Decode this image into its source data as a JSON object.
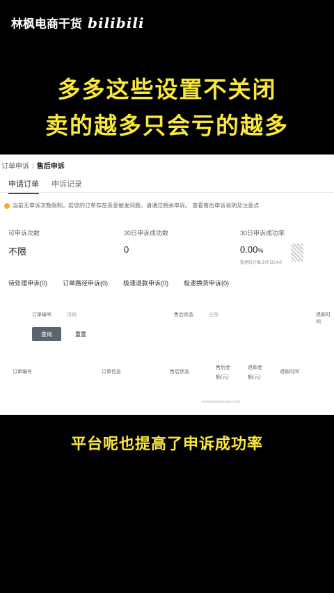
{
  "brand": {
    "name": "林枫电商干货",
    "logo": "bilibili"
  },
  "headline": {
    "line1": "多多这些设置不关闭",
    "line2": "卖的越多只会亏的越多"
  },
  "screenshot": {
    "breadcrumb": {
      "parent": "订单申诉",
      "current": "售后申诉"
    },
    "tabs": [
      "申请订单",
      "申诉记录"
    ],
    "notice": "当前无申诉次数限制，若您的订单存在恶意催发问题，请通过相关申诉。 查看售后申诉说明及注意点",
    "stats": [
      {
        "label": "可申诉次数",
        "value": "不限"
      },
      {
        "label": "30日申诉成功数",
        "value": "0"
      },
      {
        "label": "30日申诉成功率",
        "value": "0.00",
        "unit": "%",
        "sub": "数据统计截止昨日24点"
      }
    ],
    "filters": [
      "待处理申诉(0)",
      "订单路径申诉(0)",
      "极速退款申诉(0)",
      "极速换货申诉(0)"
    ],
    "form": {
      "order_no_label": "订单编号",
      "order_no_value": "请输",
      "status_label": "售后状态",
      "status_value": "全部",
      "refund_label": "退款时间"
    },
    "buttons": {
      "query": "查询",
      "reset": "重置"
    },
    "table_headers": [
      "订单编号",
      "订单信息",
      "售后状态",
      "售后金额(元)",
      "退款金额(元)",
      "退款时间"
    ],
    "watermark": "www.pinduoduo.com"
  },
  "bottom_caption": "平台呢也提高了申诉成功率"
}
